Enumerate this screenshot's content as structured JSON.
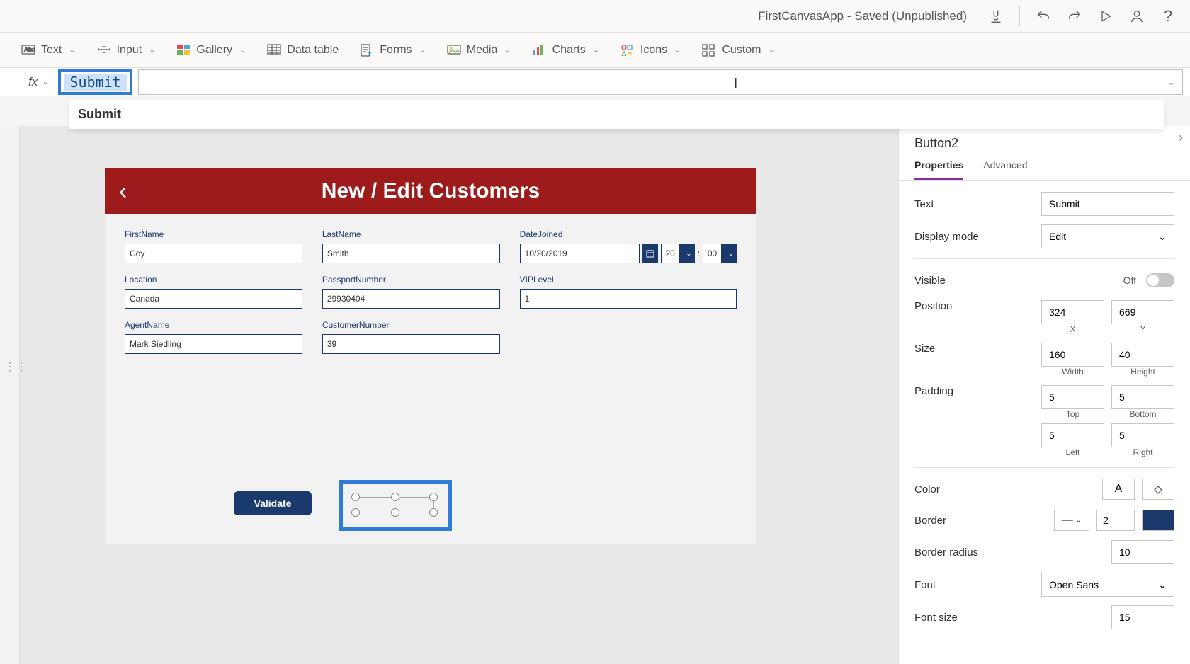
{
  "title_bar": {
    "app_title": "FirstCanvasApp - Saved (Unpublished)"
  },
  "ribbon": {
    "items": [
      "Text",
      "Input",
      "Gallery",
      "Data table",
      "Forms",
      "Media",
      "Charts",
      "Icons",
      "Custom"
    ]
  },
  "formula_bar": {
    "fx_label": "fx",
    "highlighted_text": "Submit",
    "suggestion": "Submit"
  },
  "canvas": {
    "screen_title": "New / Edit Customers",
    "fields": {
      "firstname": {
        "label": "FirstName",
        "value": "Coy"
      },
      "lastname": {
        "label": "LastName",
        "value": "Smith"
      },
      "datejoined": {
        "label": "DateJoined",
        "date": "10/20/2019",
        "hour": "20",
        "minute": "00"
      },
      "location": {
        "label": "Location",
        "value": "Canada"
      },
      "passport": {
        "label": "PassportNumber",
        "value": "29930404"
      },
      "viplevel": {
        "label": "VIPLevel",
        "value": "1"
      },
      "agent": {
        "label": "AgentName",
        "value": "Mark Siedling"
      },
      "custnum": {
        "label": "CustomerNumber",
        "value": "39"
      }
    },
    "validate_button": "Validate"
  },
  "properties_panel": {
    "control_name": "Button2",
    "tabs": {
      "properties": "Properties",
      "advanced": "Advanced"
    },
    "props": {
      "text": {
        "label": "Text",
        "value": "Submit"
      },
      "display_mode": {
        "label": "Display mode",
        "value": "Edit"
      },
      "visible": {
        "label": "Visible",
        "state": "Off"
      },
      "position": {
        "label": "Position",
        "x": "324",
        "y": "669",
        "xl": "X",
        "yl": "Y"
      },
      "size": {
        "label": "Size",
        "w": "160",
        "h": "40",
        "wl": "Width",
        "hl": "Height"
      },
      "padding": {
        "label": "Padding",
        "t": "5",
        "b": "5",
        "l": "5",
        "r": "5",
        "tl": "Top",
        "bl": "Bottom",
        "ll": "Left",
        "rl": "Right"
      },
      "color": {
        "label": "Color"
      },
      "border": {
        "label": "Border",
        "width": "2"
      },
      "border_radius": {
        "label": "Border radius",
        "value": "10"
      },
      "font": {
        "label": "Font",
        "value": "Open Sans"
      },
      "font_size": {
        "label": "Font size",
        "value": "15"
      }
    }
  }
}
